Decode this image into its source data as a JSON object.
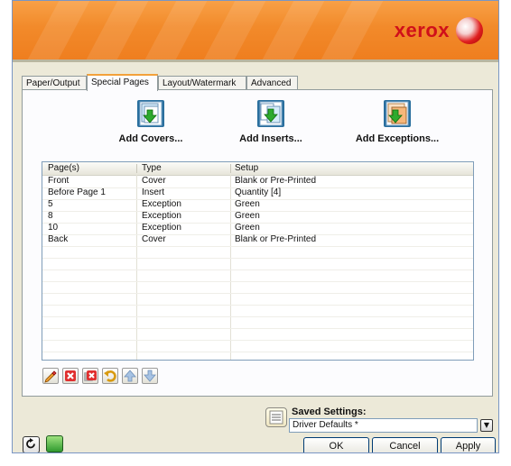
{
  "brand": {
    "logo_text": "xerox",
    "accent_color": "#d0101a",
    "banner_color": "#f28a2a"
  },
  "tabs": [
    {
      "label": "Paper/Output",
      "active": false
    },
    {
      "label": "Special Pages",
      "active": true
    },
    {
      "label": "Layout/Watermark",
      "active": false
    },
    {
      "label": "Advanced",
      "active": false
    }
  ],
  "actions": {
    "add_covers": {
      "label": "Add Covers...",
      "icon": "add-covers-icon"
    },
    "add_inserts": {
      "label": "Add Inserts...",
      "icon": "add-inserts-icon"
    },
    "add_exceptions": {
      "label": "Add Exceptions...",
      "icon": "add-exceptions-icon"
    }
  },
  "table": {
    "columns": [
      "Page(s)",
      "Type",
      "Setup"
    ],
    "rows": [
      [
        "Front",
        "Cover",
        "Blank or Pre-Printed"
      ],
      [
        "Before Page 1",
        "Insert",
        "Quantity [4]"
      ],
      [
        "5",
        "Exception",
        "Green"
      ],
      [
        "8",
        "Exception",
        "Green"
      ],
      [
        "10",
        "Exception",
        "Green"
      ],
      [
        "Back",
        "Cover",
        "Blank or Pre-Printed"
      ]
    ]
  },
  "toolbar": {
    "icons": [
      "edit-icon",
      "delete-icon",
      "delete-all-icon",
      "undo-icon",
      "move-up-icon",
      "move-down-icon"
    ]
  },
  "saved_settings": {
    "label": "Saved Settings:",
    "value": "Driver Defaults *"
  },
  "buttons": {
    "ok": "OK",
    "cancel": "Cancel",
    "apply": "Apply"
  }
}
